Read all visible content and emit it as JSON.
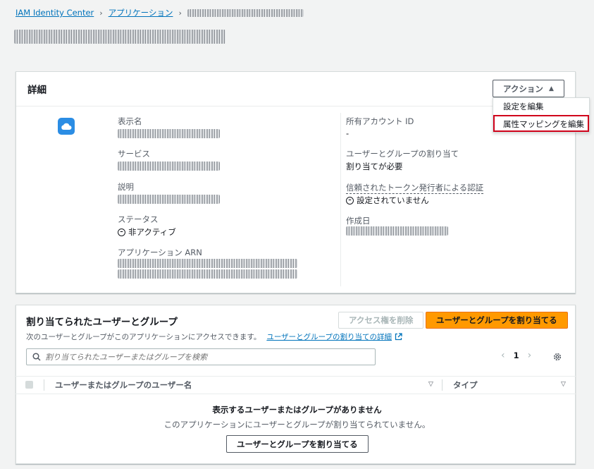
{
  "breadcrumb": {
    "root": "IAM Identity Center",
    "applications": "アプリケーション",
    "separator": "›"
  },
  "details": {
    "title": "詳細",
    "actions_button": "アクション",
    "actions_caret": "▲",
    "menu": [
      {
        "label": "設定を編集"
      },
      {
        "label": "属性マッピングを編集"
      }
    ],
    "left": {
      "display_name_label": "表示名",
      "service_label": "サービス",
      "description_label": "説明",
      "status_label": "ステータス",
      "status_value": "非アクティブ",
      "arn_label": "アプリケーション ARN"
    },
    "right": {
      "owner_account_label": "所有アカウント ID",
      "owner_account_value": "-",
      "assignment_label": "ユーザーとグループの割り当て",
      "assignment_value": "割り当てが必要",
      "trusted_token_label": "信頼されたトークン発行者による認証",
      "trusted_token_value": "設定されていません",
      "created_label": "作成日"
    },
    "status_icon": "minus-circle-icon",
    "app_icon": "cloud-icon"
  },
  "assignments": {
    "title": "割り当てられたユーザーとグループ",
    "description": "次のユーザーとグループがこのアプリケーションにアクセスできます。",
    "learn_more_link": "ユーザーとグループの割り当ての詳細",
    "remove_button": "アクセス権を削除",
    "assign_button": "ユーザーとグループを割り当てる",
    "search_placeholder": "割り当てられたユーザーまたはグループを検索",
    "page_number": "1",
    "columns": [
      {
        "label": "ユーザーまたはグループのユーザー名"
      },
      {
        "label": "タイプ"
      }
    ],
    "empty_title": "表示するユーザーまたはグループがありません",
    "empty_desc": "このアプリケーションにユーザーとグループが割り当てられていません。",
    "empty_button": "ユーザーとグループを割り当てる"
  },
  "colors": {
    "link": "#0073bb",
    "primary": "#ff9900",
    "highlight": "#d0021b",
    "app_icon": "#2b8de4"
  }
}
